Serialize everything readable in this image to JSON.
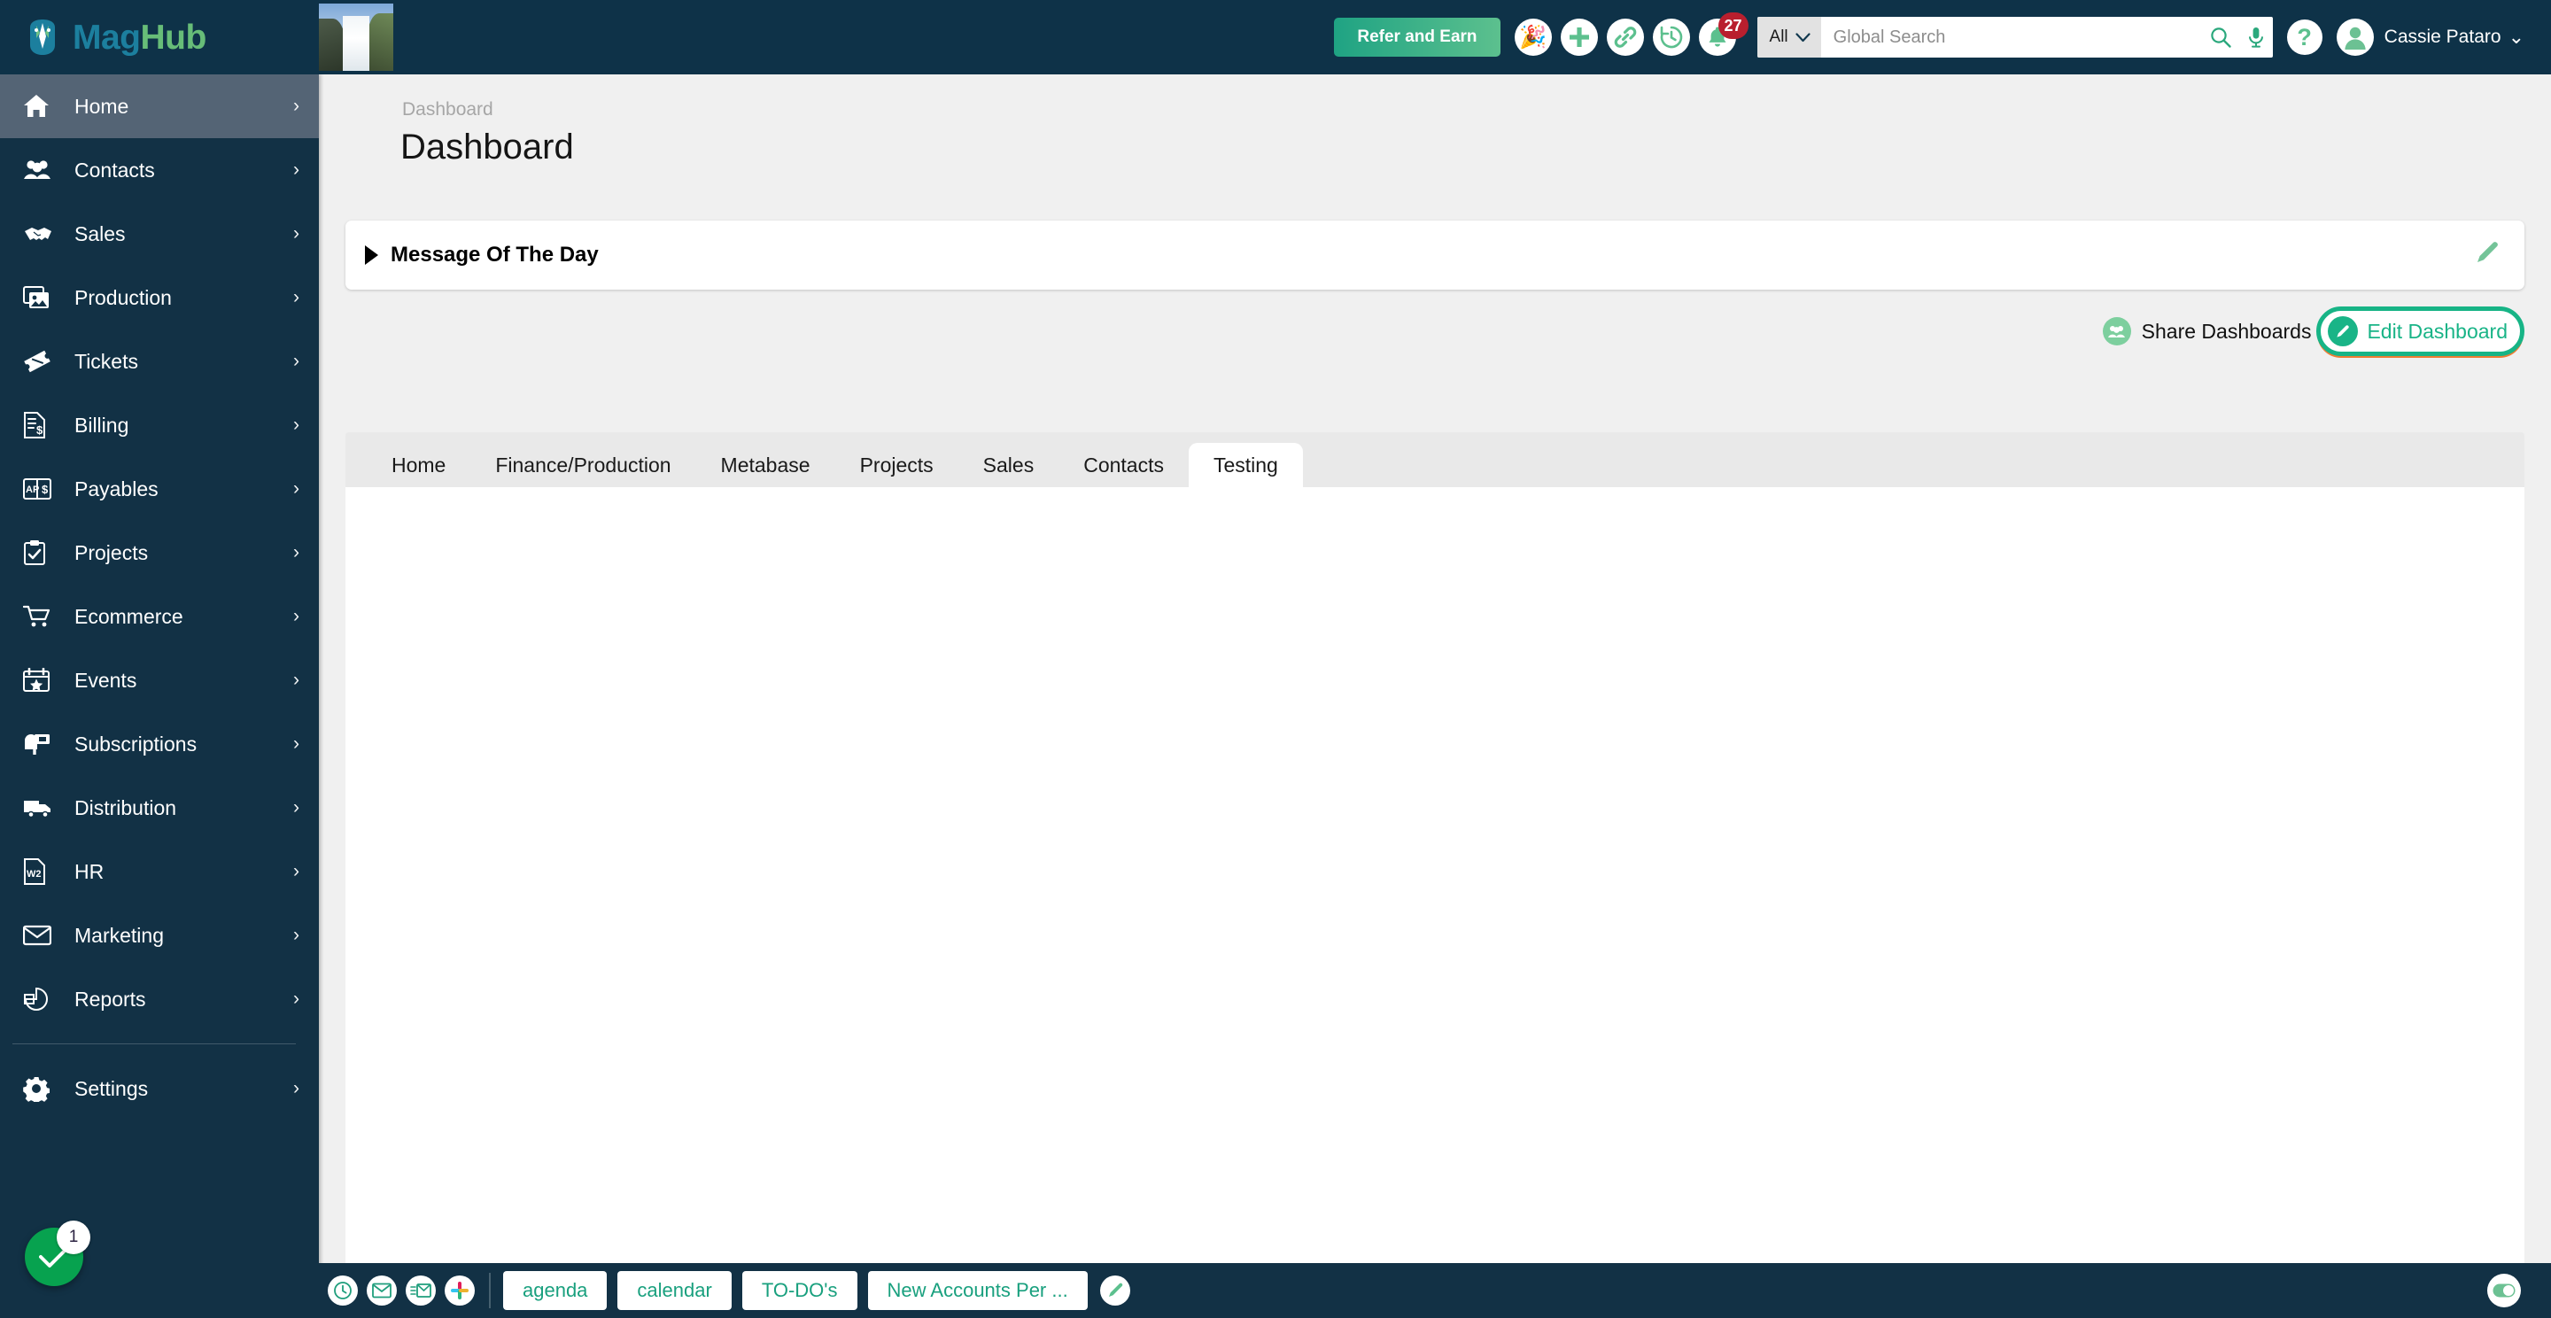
{
  "topbar": {
    "brand": {
      "mag": "Mag",
      "hub": "Hub",
      "logo_icon": "maghub-dragon-logo"
    },
    "company_thumb_name": "waterfall-photo",
    "refer_label": "Refer and Earn",
    "icons": [
      {
        "name": "party-popper-icon",
        "glyph": "🎉"
      },
      {
        "name": "plus-icon"
      },
      {
        "name": "link-icon"
      },
      {
        "name": "history-clock-icon"
      },
      {
        "name": "bell-icon",
        "badge": "27"
      }
    ],
    "search": {
      "scope": "All",
      "placeholder": "Global Search",
      "value": ""
    },
    "help_label": "?",
    "user": {
      "name": "Cassie Pataro",
      "caret": "⌄"
    }
  },
  "sidebar": {
    "items": [
      {
        "label": "Home",
        "icon": "home-icon",
        "active": true
      },
      {
        "label": "Contacts",
        "icon": "contacts-icon",
        "active": false
      },
      {
        "label": "Sales",
        "icon": "handshake-icon",
        "active": false
      },
      {
        "label": "Production",
        "icon": "image-stack-icon",
        "active": false
      },
      {
        "label": "Tickets",
        "icon": "ticket-icon",
        "active": false
      },
      {
        "label": "Billing",
        "icon": "invoice-dollar-icon",
        "active": false
      },
      {
        "label": "Payables",
        "icon": "ap-dollar-icon",
        "active": false
      },
      {
        "label": "Projects",
        "icon": "clipboard-check-icon",
        "active": false
      },
      {
        "label": "Ecommerce",
        "icon": "shopping-cart-icon",
        "active": false
      },
      {
        "label": "Events",
        "icon": "calendar-star-icon",
        "active": false
      },
      {
        "label": "Subscriptions",
        "icon": "mailbox-icon",
        "active": false
      },
      {
        "label": "Distribution",
        "icon": "truck-icon",
        "active": false
      },
      {
        "label": "HR",
        "icon": "w2-document-icon",
        "active": false
      },
      {
        "label": "Marketing",
        "icon": "envelope-icon",
        "active": false
      },
      {
        "label": "Reports",
        "icon": "pie-chart-icon",
        "active": false
      }
    ],
    "settings": {
      "label": "Settings",
      "icon": "gear-icon"
    },
    "chevron": "›",
    "fab": {
      "icon": "check-icon",
      "badge": "1"
    }
  },
  "main": {
    "breadcrumb": "Dashboard",
    "title": "Dashboard",
    "motd": {
      "title": "Message Of The Day",
      "collapse_icon": "triangle-right-icon",
      "edit_icon": "pencil-icon"
    },
    "share_dashboards_label": "Share Dashboards",
    "edit_dashboard_label": "Edit Dashboard",
    "tabs": [
      {
        "label": "Home",
        "active": false
      },
      {
        "label": "Finance/Production",
        "active": false
      },
      {
        "label": "Metabase",
        "active": false
      },
      {
        "label": "Projects",
        "active": false
      },
      {
        "label": "Sales",
        "active": false
      },
      {
        "label": "Contacts",
        "active": false
      },
      {
        "label": "Testing",
        "active": true
      }
    ]
  },
  "bottombar": {
    "icons": [
      {
        "name": "clock-icon"
      },
      {
        "name": "envelope-icon"
      },
      {
        "name": "envelope-lines-icon"
      },
      {
        "name": "slack-icon"
      }
    ],
    "tabs": [
      "agenda",
      "calendar",
      "TO-DO's",
      "New Accounts Per ..."
    ],
    "pencil_icon": "pencil-icon",
    "toggle_icon": "toggle-on-icon"
  },
  "colors": {
    "topbar_bg": "#0e3248",
    "sidebar_bg": "#123145",
    "sidebar_active": "#546475",
    "accent_green": "#19b487",
    "brand_green": "#67bd78",
    "brand_teal": "#1c7f9e",
    "badge_red": "#b91f2e",
    "highlight_ring": "#17b486"
  }
}
